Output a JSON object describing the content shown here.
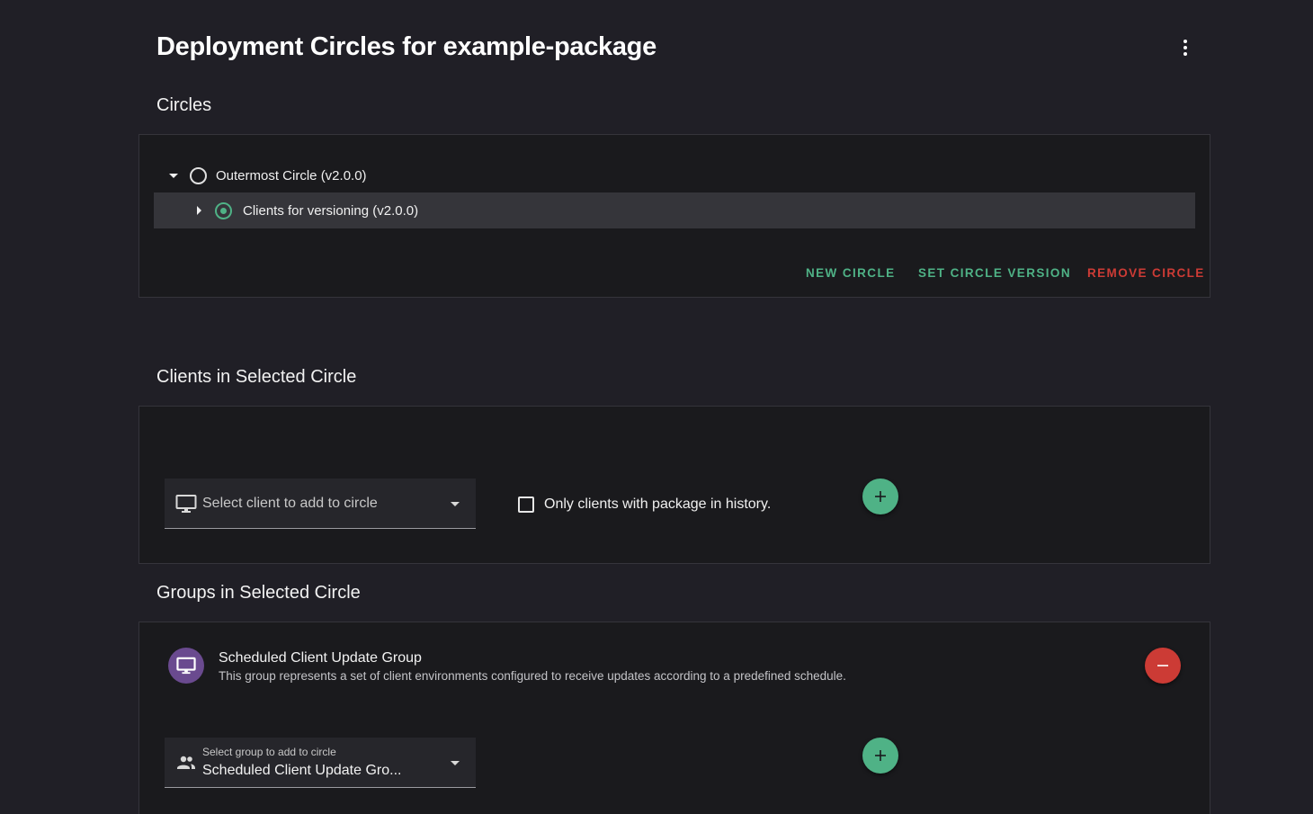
{
  "header": {
    "title": "Deployment Circles for example-package",
    "menu_icon": "more-vert-icon"
  },
  "circles": {
    "section_title": "Circles",
    "tree": [
      {
        "label": "Outermost Circle (v2.0.0)",
        "expanded": true,
        "selected": false
      },
      {
        "label": "Clients for versioning (v2.0.0)",
        "expanded": false,
        "selected": true
      }
    ],
    "actions": {
      "new_circle": "New Circle",
      "set_circle_version": "Set Circle Version",
      "remove_circle": "Remove Circle"
    }
  },
  "clients": {
    "section_title": "Clients in Selected Circle",
    "select_placeholder": "Select client to add to circle",
    "filter_label": "Only clients with package in history.",
    "filter_checked": false
  },
  "groups": {
    "section_title": "Groups in Selected Circle",
    "items": [
      {
        "name": "Scheduled Client Update Group",
        "description": "This group represents a set of client environments configured to receive updates according to a predefined schedule."
      }
    ],
    "select_label": "Select group to add to circle",
    "select_value": "Scheduled Client Update Gro..."
  },
  "colors": {
    "accent_green": "#4fb286",
    "danger_red": "#cc3b35",
    "avatar_purple": "#6a4a8f",
    "background": "#201f26",
    "panel": "#1a1a1d"
  }
}
